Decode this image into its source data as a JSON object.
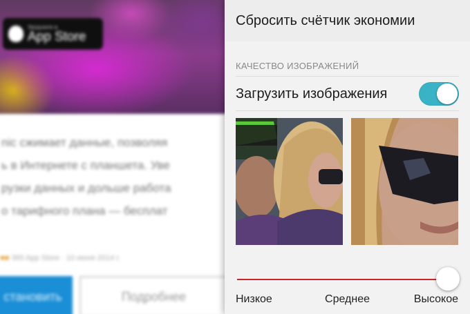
{
  "background": {
    "badge_small": "Загрузите в",
    "badge_big": "App Store",
    "text_lines": [
      "nic сжимает данные, позволяя",
      "ь в Интернете с планшета. Уве",
      "рузки данных и дольше работа",
      "о тарифного плана — бесплат"
    ],
    "meta": "365 App Store · 10 июня 2014 г.",
    "button_primary": "становить",
    "button_secondary": "Подробнее"
  },
  "panel": {
    "reset_label": "Сбросить счётчик экономии",
    "section_title": "КАЧЕСТВО ИЗОБРАЖЕНИЙ",
    "load_images_label": "Загрузить изображения",
    "load_images_on": true,
    "toggle_color": "#3bb3c7",
    "slider": {
      "labels": [
        "Низкое",
        "Среднее",
        "Высокое"
      ],
      "value": "Высокое",
      "accent": "#c9242b"
    }
  }
}
